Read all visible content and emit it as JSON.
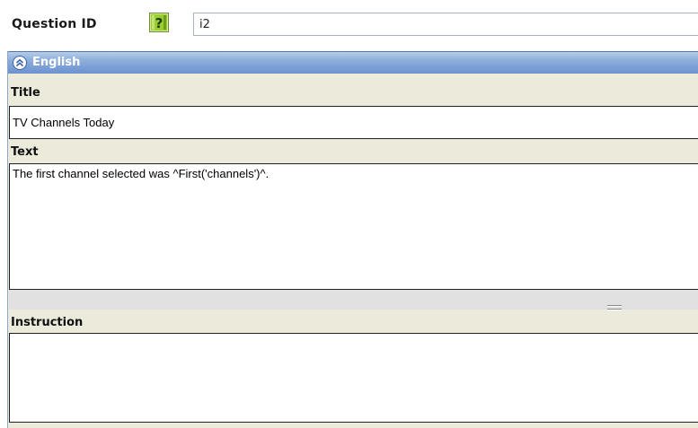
{
  "question_id": {
    "label": "Question ID",
    "value": "i2",
    "help_icon": "help-question-icon"
  },
  "language_section": {
    "name": "English",
    "collapse_icon": "chevron-double-up-icon",
    "header_color": "#7b9fd8"
  },
  "fields": {
    "title": {
      "label": "Title",
      "value": "TV Channels Today"
    },
    "text": {
      "label": "Text",
      "value": "The first channel selected was ^First('channels')^."
    },
    "instruction": {
      "label": "Instruction",
      "value": ""
    }
  },
  "colors": {
    "panel_background": "#ebeadb",
    "field_background": "#ffffff",
    "help_icon_green": "#5cb85c"
  }
}
